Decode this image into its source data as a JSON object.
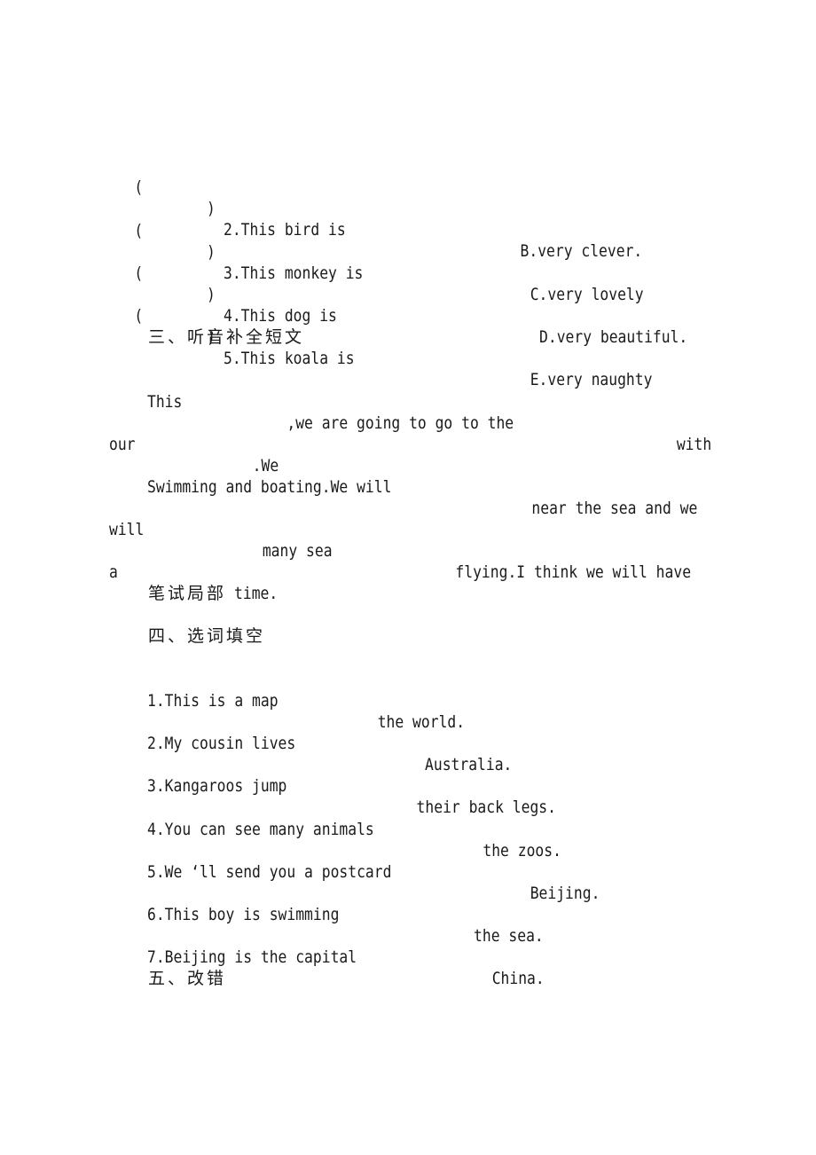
{
  "matching": {
    "items": [
      {
        "paren_open": "(",
        "paren_close": ")",
        "question": "2.This bird is",
        "option": "B.very clever."
      },
      {
        "paren_open": "(",
        "paren_close": ")",
        "question": "3.This monkey is",
        "option": "C.very lovely"
      },
      {
        "paren_open": "(",
        "paren_close": ")",
        "question": "4.This dog is",
        "option": "D.very beautiful."
      },
      {
        "paren_open": "(",
        "paren_close": ")",
        "question": "5.This koala is",
        "option": "E.very naughty"
      }
    ]
  },
  "section3": {
    "heading": "三、听音补全短文",
    "passage": {
      "l1": {
        "a": "This",
        "b": ",we are going to go to the",
        "c": "with"
      },
      "l2": {
        "a": "our",
        "b": ".We"
      },
      "l3": {
        "a": "Swimming and boating.We will",
        "b": "near the sea and we"
      },
      "l4": {
        "a": "will",
        "b": "many sea",
        "c": "flying.I think we will have"
      },
      "l5": {
        "a": "a",
        "b": "time."
      }
    }
  },
  "written_part": {
    "heading": "笔试局部"
  },
  "section4": {
    "heading": "四、选词填空",
    "items": [
      {
        "before": "1.This is a map",
        "after": "the world."
      },
      {
        "before": "2.My cousin lives",
        "after": "Australia."
      },
      {
        "before": "3.Kangaroos jump",
        "after": "their back legs."
      },
      {
        "before": "4.You can see many animals",
        "after": "the zoos."
      },
      {
        "before": "5.We ‘ll send you a postcard",
        "after": "Beijing."
      },
      {
        "before": "6.This boy is swimming",
        "after": "the sea."
      },
      {
        "before": "7.Beijing is the capital",
        "after": "China."
      }
    ]
  },
  "section5": {
    "heading": "五、改错"
  }
}
